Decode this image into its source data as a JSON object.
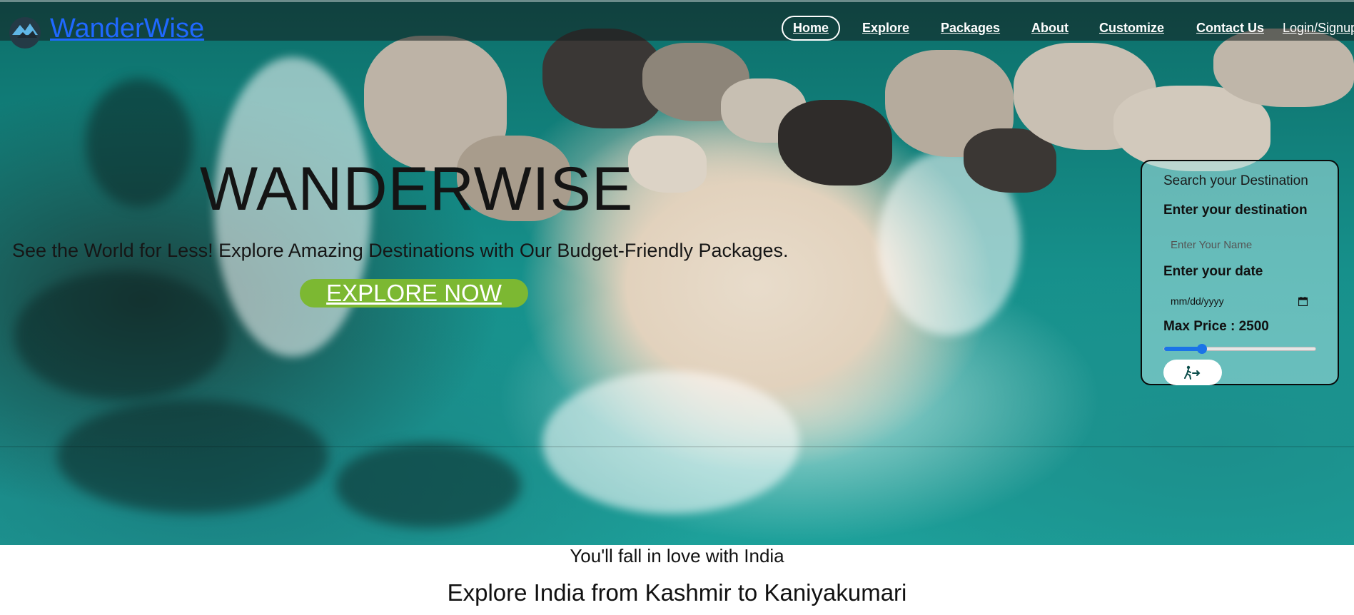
{
  "brand": {
    "name": "WanderWise",
    "color": "#1f68ff"
  },
  "nav": {
    "items": [
      {
        "label": "Home",
        "active": true
      },
      {
        "label": "Explore"
      },
      {
        "label": "Packages"
      },
      {
        "label": "About"
      },
      {
        "label": "Customize"
      },
      {
        "label": "Contact Us"
      }
    ],
    "login": "Login/Signup"
  },
  "hero": {
    "title": "WANDERWISE",
    "subtitle": "See the World for Less! Explore Amazing Destinations with Our Budget-Friendly Packages.",
    "cta": "EXPLORE NOW",
    "cta_color": "#7cb832"
  },
  "search": {
    "title": "Search your Destination",
    "destination_label": "Enter your destination",
    "destination_placeholder": "Enter Your Name",
    "date_label": "Enter your date",
    "date_placeholder": "mm/dd/yyyy",
    "price_label": "Max Price : 2500",
    "price_fraction": 0.25,
    "submit_icon": "person-walking-arrow-icon",
    "slider_color": "#1a73e8"
  },
  "intro": {
    "tagline": "You'll fall in love with India",
    "headline": "Explore India from Kashmir to Kaniyakumari"
  }
}
